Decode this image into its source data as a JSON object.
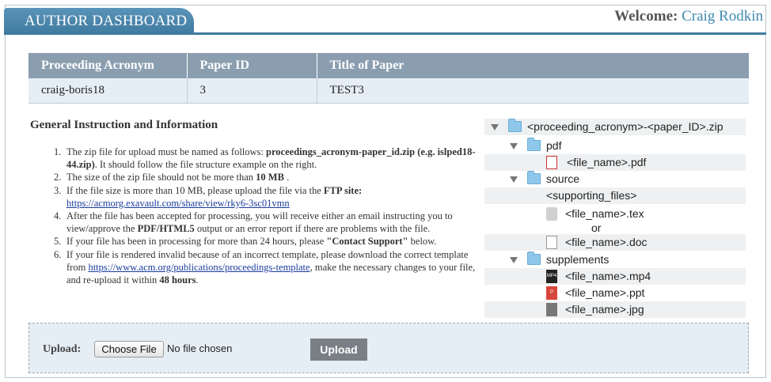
{
  "header": {
    "title": "AUTHOR DASHBOARD",
    "welcome_label": "Welcome:",
    "user_name": "Craig Rodkin"
  },
  "table": {
    "columns": [
      "Proceeding Acronym",
      "Paper ID",
      "Title of Paper"
    ],
    "rows": [
      [
        "craig-boris18",
        "3",
        "TEST3"
      ]
    ]
  },
  "instructions": {
    "title": "General Instruction and Information",
    "items": [
      {
        "num": "1.",
        "parts": [
          {
            "t": "The zip file for upload must be named as follows: "
          },
          {
            "t": "proceedings_acronym-paper_id.zip (e.g. islped18-44.zip)",
            "b": true
          },
          {
            "t": ". It should follow the file structure example on the right."
          }
        ]
      },
      {
        "num": "2.",
        "parts": [
          {
            "t": "The size of the zip file should not be more than "
          },
          {
            "t": "10 MB",
            "b": true
          },
          {
            "t": " ."
          }
        ]
      },
      {
        "num": "3.",
        "parts": [
          {
            "t": "If the file size is more than 10 MB, please upload the file via the "
          },
          {
            "t": "FTP site:",
            "b": true
          },
          {
            "t": " "
          },
          {
            "t": "https://acmorg.exavault.com/share/view/rky6-3sc01vmn",
            "link": true
          }
        ]
      },
      {
        "num": "4.",
        "parts": [
          {
            "t": "After the file has been accepted for processing, you will receive either an email instructing you to view/approve the "
          },
          {
            "t": "PDF/HTML5",
            "b": true
          },
          {
            "t": " output or an error report if there are problems with the file."
          }
        ]
      },
      {
        "num": "5.",
        "parts": [
          {
            "t": "If your file has been in processing for more than 24 hours, please "
          },
          {
            "t": "\"Contact Support\"",
            "b": true
          },
          {
            "t": " below."
          }
        ]
      },
      {
        "num": "6.",
        "parts": [
          {
            "t": "If your file is rendered invalid because of an incorrect template, please download the correct template from "
          },
          {
            "t": "https://www.acm.org/publications/proceedings-template",
            "link": true
          },
          {
            "t": ", make the necessary changes to your file, and re-upload it within "
          },
          {
            "t": "48 hours",
            "b": true
          },
          {
            "t": "."
          }
        ]
      }
    ]
  },
  "file_tree": {
    "root": "<proceeding_acronym>-<paper_ID>.zip",
    "pdf_folder": "pdf",
    "pdf_file": "<file_name>.pdf",
    "source_folder": "source",
    "supporting": "<supporting_files>",
    "tex_file": "<file_name>.tex",
    "or_text": "or",
    "doc_file": "<file_name>.doc",
    "supplements_folder": "supplements",
    "mp4_file": "<file_name>.mp4",
    "ppt_file": "<file_name>.ppt",
    "jpg_file": "<file_name>.jpg",
    "icons": {
      "pdf": "pdf-file-icon",
      "tex": "tex-file-icon",
      "doc": "doc-file-icon",
      "mp4": "mp4-file-icon",
      "ppt": "ppt-file-icon",
      "jpg": "jpg-file-icon"
    },
    "icon_text": {
      "mp4": "MP4",
      "ppt": "P"
    }
  },
  "upload": {
    "label": "Upload:",
    "choose_button": "Choose File",
    "no_file_text": "No file chosen",
    "upload_button": "Upload"
  },
  "colors": {
    "header_blue": "#3f7aa0",
    "table_header": "#8a9eb0",
    "row_bg": "#e6eef5",
    "welcome_name": "#3f8ab0",
    "upload_button": "#7a7f85"
  }
}
